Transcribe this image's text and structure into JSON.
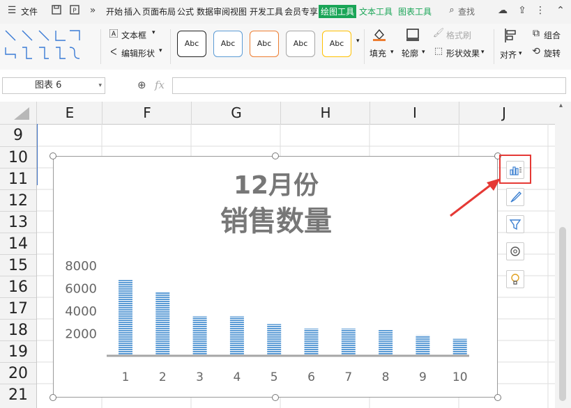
{
  "menubar": {
    "file_label": "文件",
    "menus": [
      "开始",
      "插入",
      "页面布局",
      "公式",
      "数据",
      "审阅",
      "视图",
      "开发工具",
      "会员专享"
    ],
    "active_tab": "绘图工具",
    "green_tabs": [
      "文本工具",
      "图表工具"
    ],
    "search_label": "查找"
  },
  "ribbon": {
    "textbox_label": "文本框",
    "edit_shape_label": "编辑形状",
    "style_label": "Abc",
    "style_colors": [
      "#222222",
      "#5b9bd5",
      "#ed7d31",
      "#a5a5a5",
      "#ffc000"
    ],
    "fill_label": "填充",
    "outline_label": "轮廓",
    "format_brush_label": "格式刷",
    "shape_effect_label": "形状效果",
    "align_label": "对齐",
    "group_label": "组合",
    "rotate_label": "旋转"
  },
  "formula_bar": {
    "name_box_value": "图表 6",
    "fx_label": "fx",
    "formula_value": ""
  },
  "grid": {
    "columns": [
      "E",
      "F",
      "G",
      "H",
      "I",
      "J"
    ],
    "rows": [
      "9",
      "10",
      "11",
      "12",
      "13",
      "14",
      "15",
      "16",
      "17",
      "18",
      "19",
      "20",
      "21"
    ]
  },
  "chart_data": {
    "type": "bar",
    "title": "12月份\n销售数量",
    "title_line1": "12月份",
    "title_line2": "销售数量",
    "categories": [
      "1",
      "2",
      "3",
      "4",
      "5",
      "6",
      "7",
      "8",
      "9",
      "10"
    ],
    "values": [
      6700,
      5600,
      3500,
      3500,
      2800,
      2400,
      2400,
      2300,
      1800,
      1500
    ],
    "ylim": [
      0,
      8000
    ],
    "yticks": [
      "2000",
      "4000",
      "6000",
      "8000"
    ],
    "bar_color": "#5b9bd5",
    "grid": false,
    "legend": "none"
  },
  "side_tools": [
    "chart-elements-icon",
    "chart-style-icon",
    "chart-filter-icon",
    "settings-icon",
    "lightbulb-icon"
  ],
  "annotation_color": "#e53935"
}
